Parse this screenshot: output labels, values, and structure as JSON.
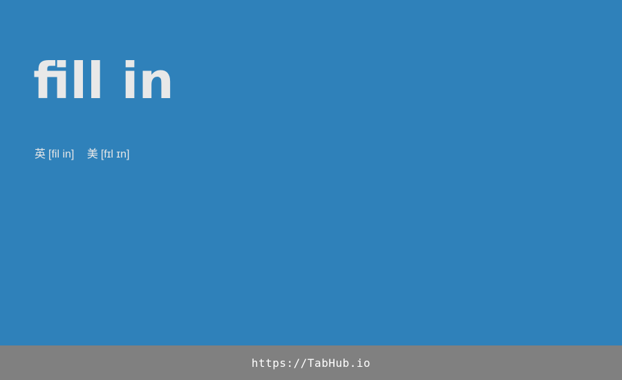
{
  "card": {
    "word": "fill in",
    "phonetics": {
      "uk": {
        "label": "英",
        "ipa": "[fil in]"
      },
      "us": {
        "label": "美",
        "ipa": "[fɪl ɪn]"
      }
    }
  },
  "footer": {
    "link_text": "https://TabHub.io"
  },
  "colors": {
    "background": "#2f81ba",
    "footer": "#808080",
    "text": "#e8e8e8"
  }
}
